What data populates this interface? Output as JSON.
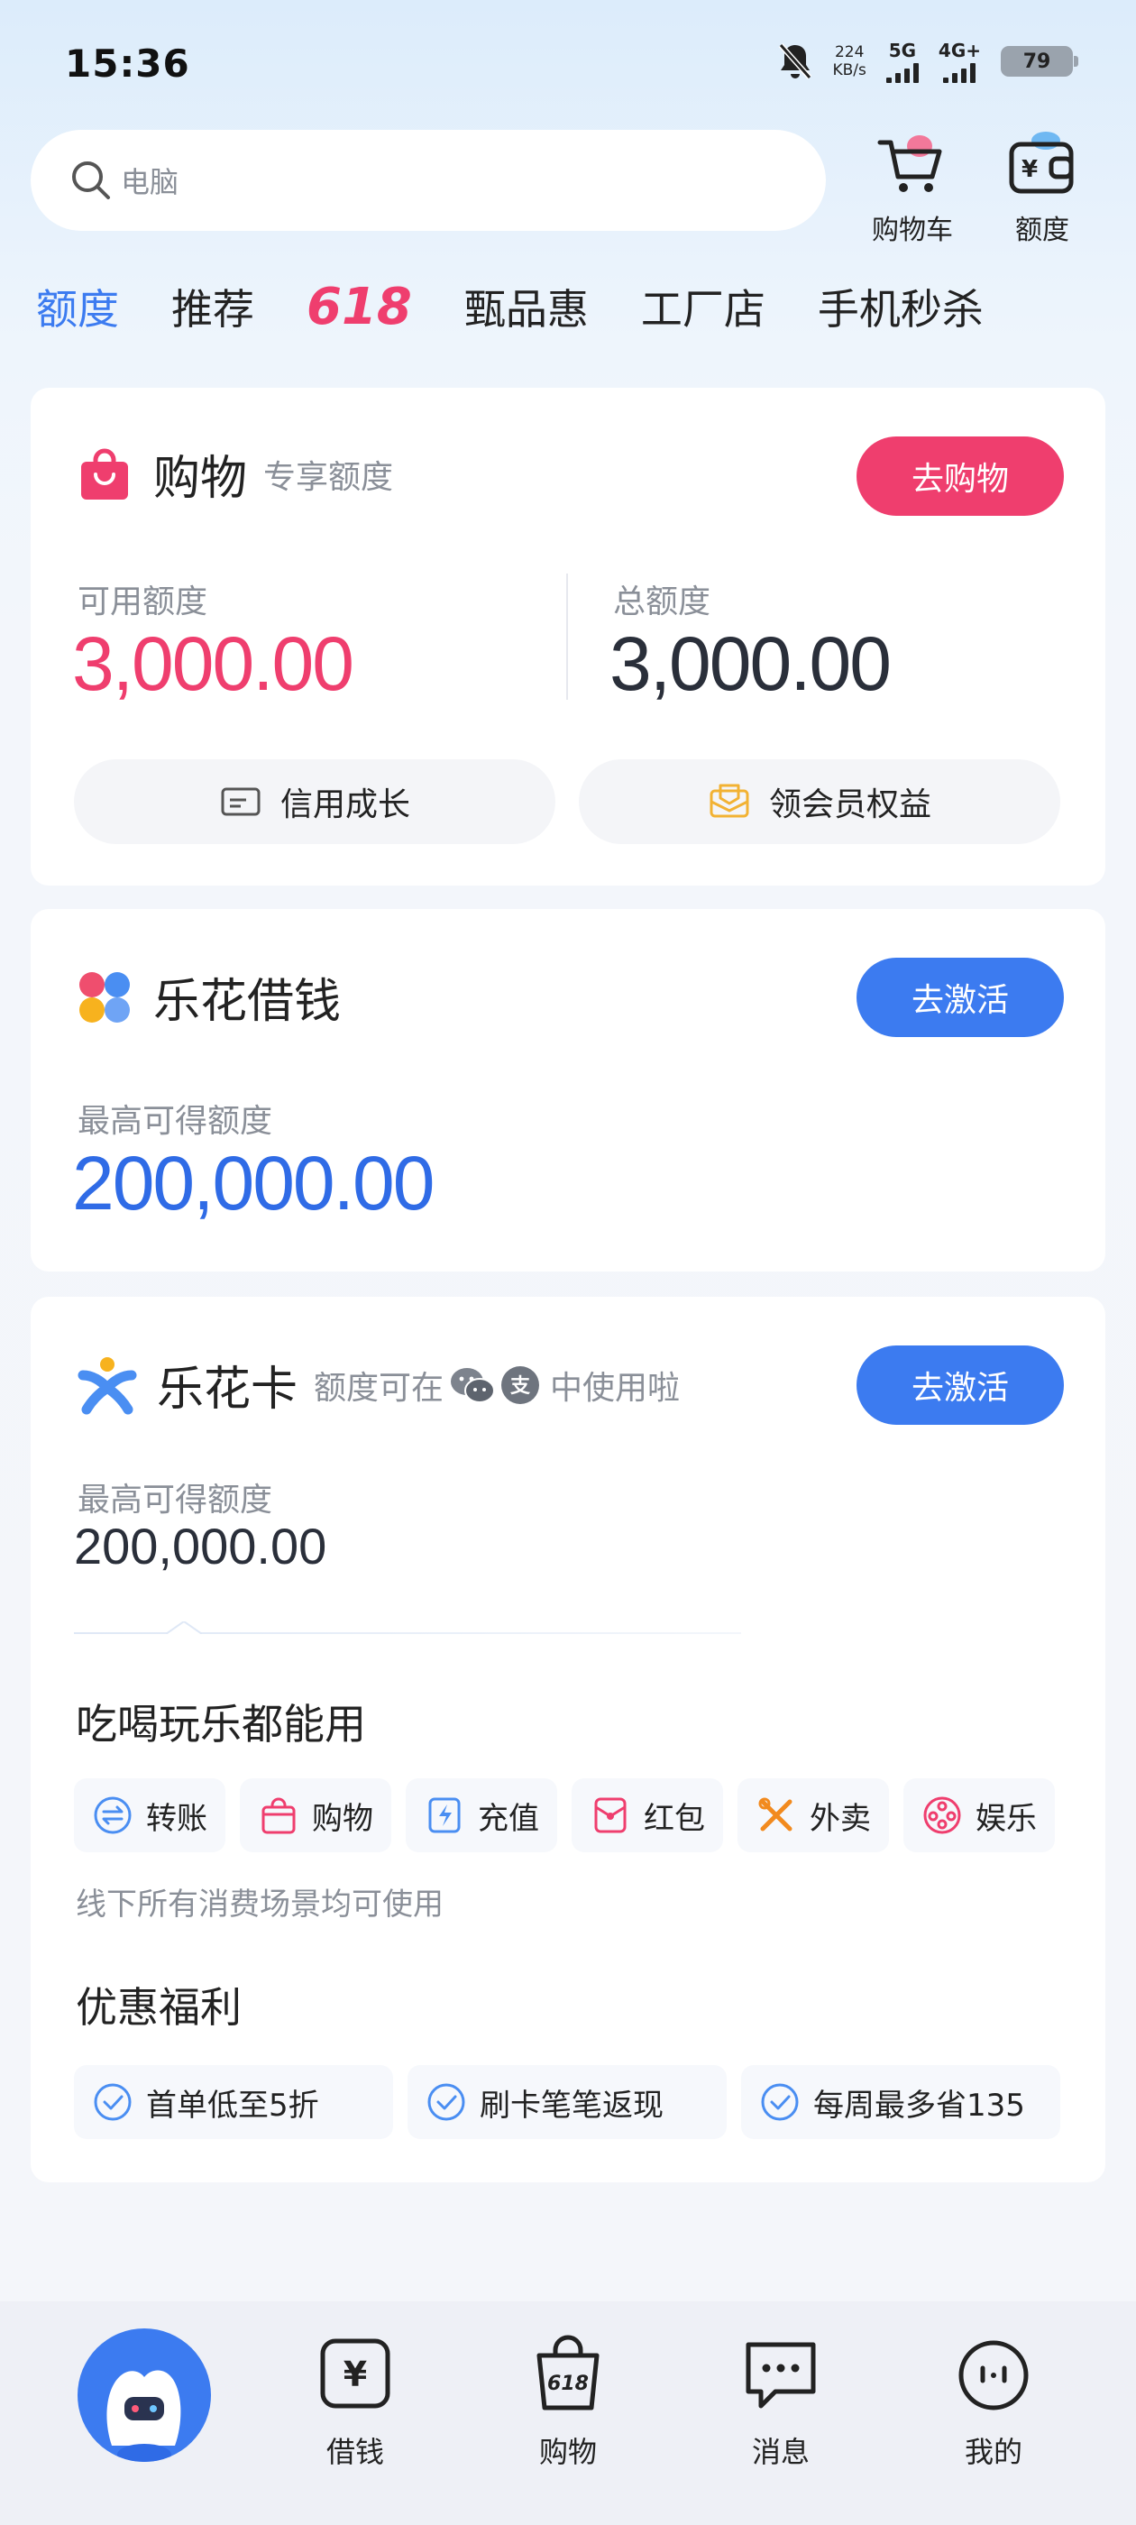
{
  "status_bar": {
    "time": "15:36",
    "net_speed_value": "224",
    "net_speed_unit": "KB/s",
    "signal_1": "5G",
    "signal_2": "4G+",
    "battery": "79"
  },
  "search": {
    "placeholder": "电脑"
  },
  "top_actions": {
    "cart_label": "购物车",
    "quota_label": "额度"
  },
  "tabs": [
    {
      "label": "额度",
      "active": true
    },
    {
      "label": "推荐"
    },
    {
      "label": "618"
    },
    {
      "label": "甄品惠"
    },
    {
      "label": "工厂店"
    },
    {
      "label": "手机秒杀"
    }
  ],
  "shopping_card": {
    "title": "购物",
    "subtitle": "专享额度",
    "button": "去购物",
    "available_label": "可用额度",
    "available_value": "3,000.00",
    "total_label": "总额度",
    "total_value": "3,000.00",
    "credit_growth": "信用成长",
    "member_benefits": "领会员权益"
  },
  "loan_card": {
    "title": "乐花借钱",
    "button": "去激活",
    "max_label": "最高可得额度",
    "max_value": "200,000.00"
  },
  "lehua_card": {
    "title": "乐花卡",
    "subtitle_prefix": "额度可在",
    "subtitle_suffix": "中使用啦",
    "button": "去激活",
    "max_label": "最高可得额度",
    "max_value": "200,000.00",
    "usage_heading": "吃喝玩乐都能用",
    "usage_items": [
      "转账",
      "购物",
      "充值",
      "红包",
      "外卖",
      "娱乐"
    ],
    "offline_note": "线下所有消费场景均可使用",
    "benefits_heading": "优惠福利",
    "benefits": [
      "首单低至5折",
      "刷卡笔笔返现",
      "每周最多省135"
    ]
  },
  "bottom_nav": [
    {
      "label": "借钱"
    },
    {
      "label": "购物"
    },
    {
      "label": "消息"
    },
    {
      "label": "我的"
    }
  ],
  "colors": {
    "accent_blue": "#3c7bf0",
    "accent_pink": "#ef3e6e",
    "text_dark": "#222222",
    "text_muted": "#8a8f98"
  }
}
